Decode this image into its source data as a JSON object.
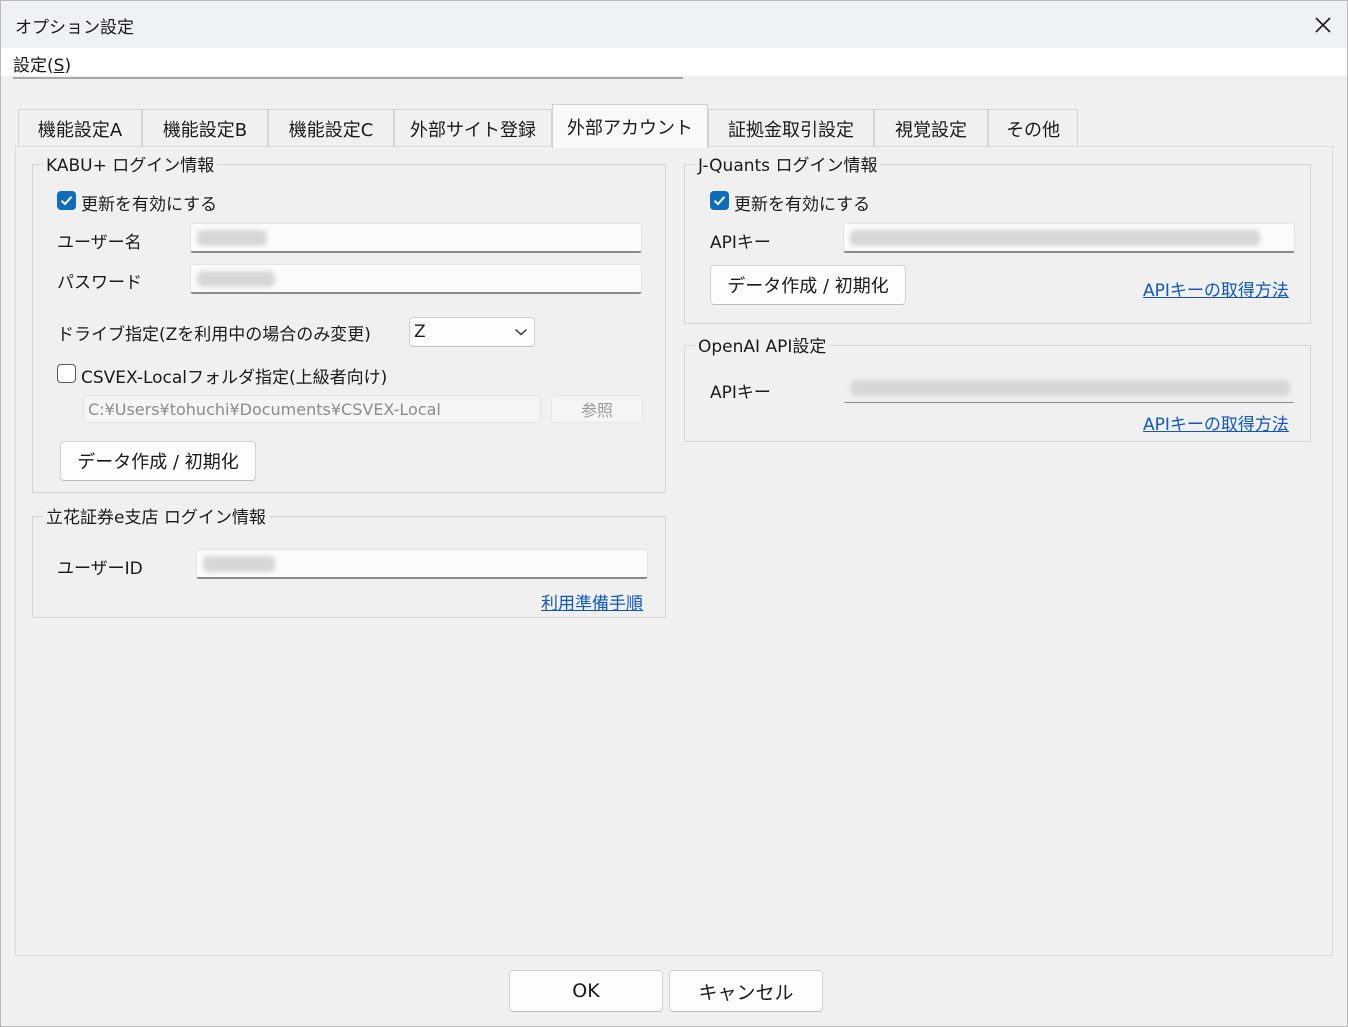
{
  "window": {
    "title": "オプション設定",
    "menu": {
      "label": "設定(",
      "accel": "S",
      "label_end": ")"
    }
  },
  "tabs": [
    {
      "label": "機能設定A"
    },
    {
      "label": "機能設定B"
    },
    {
      "label": "機能設定C"
    },
    {
      "label": "外部サイト登録"
    },
    {
      "label": "外部アカウント",
      "active": true
    },
    {
      "label": "証拠金取引設定"
    },
    {
      "label": "視覚設定"
    },
    {
      "label": "その他"
    }
  ],
  "kabu": {
    "title": "KABU+ ログイン情報",
    "enable_label": "更新を有効にする",
    "enable_checked": true,
    "username_label": "ユーザー名",
    "password_label": "パスワード",
    "drive_label": "ドライブ指定(Zを利用中の場合のみ変更)",
    "drive_value": "Z",
    "folder_label": "CSVEX-Localフォルダ指定(上級者向け)",
    "folder_checked": false,
    "folder_path": "C:¥Users¥tohuchi¥Documents¥CSVEX-Local",
    "browse_label": "参照",
    "init_button": "データ作成 / 初期化"
  },
  "tachibana": {
    "title": "立花証券e支店 ログイン情報",
    "userid_label": "ユーザーID",
    "guide_link": "利用準備手順"
  },
  "jquants": {
    "title": "J-Quants ログイン情報",
    "enable_label": "更新を有効にする",
    "enable_checked": true,
    "apikey_label": "APIキー",
    "init_button": "データ作成 / 初期化",
    "help_link": "APIキーの取得方法"
  },
  "openai": {
    "title": "OpenAI API設定",
    "apikey_label": "APIキー",
    "help_link": "APIキーの取得方法"
  },
  "footer": {
    "ok_label": "OK",
    "cancel_label": "キャンセル"
  },
  "colors": {
    "accent": "#0f6cbd",
    "link": "#0f57c6",
    "window_bg": "#f0f0f0"
  }
}
